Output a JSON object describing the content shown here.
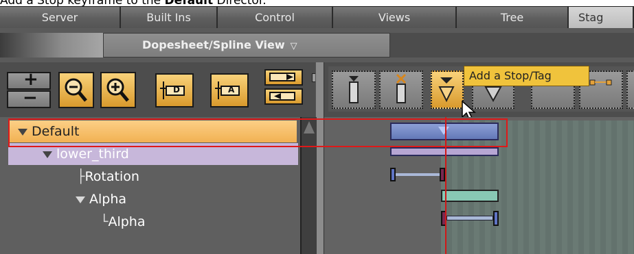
{
  "caption": {
    "prefix": "Add a Stop keyframe to the ",
    "bold": "Default",
    "suffix": " Director."
  },
  "tabs": [
    {
      "label": "Server"
    },
    {
      "label": "Built Ins"
    },
    {
      "label": "Control"
    },
    {
      "label": "Views"
    },
    {
      "label": "Tree"
    },
    {
      "label": "Stag"
    }
  ],
  "dopesheet": {
    "title": "Dopesheet/Spline View",
    "dropdown_icon": "chevron-down-icon"
  },
  "toolbar": {
    "zoom_plus": "+",
    "zoom_minus": "−",
    "tag_d": "D",
    "tag_a": "A",
    "tooltip": "Add a Stop/Tag"
  },
  "tree": {
    "rows": [
      {
        "label": "Default"
      },
      {
        "label": "lower_third"
      },
      {
        "label": "Rotation"
      },
      {
        "label": "Alpha"
      },
      {
        "label": "Alpha"
      }
    ]
  },
  "colors": {
    "selected_row": "#f4b860",
    "container_row": "#c7b7da",
    "highlight_box": "#e01818",
    "tooltip_bg": "#f0c33c"
  }
}
